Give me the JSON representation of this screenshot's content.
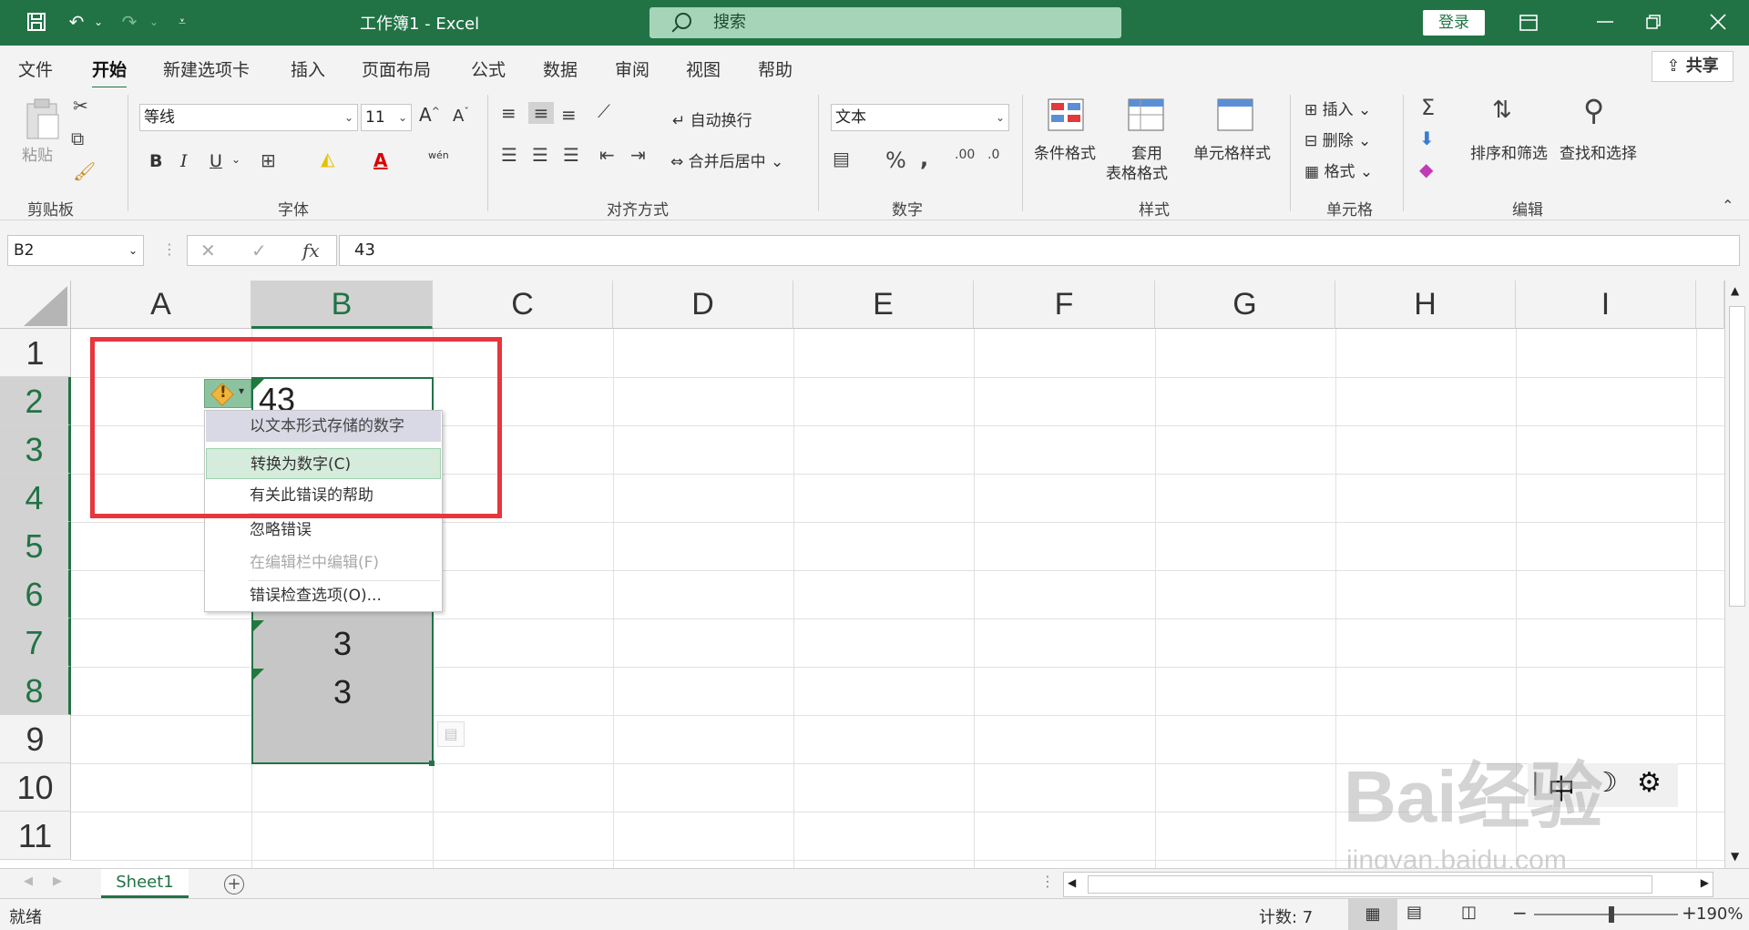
{
  "titlebar": {
    "doc_title": "工作簿1  -  Excel",
    "search_placeholder": "搜索",
    "login": "登录"
  },
  "tabs": [
    {
      "label": "文件"
    },
    {
      "label": "开始"
    },
    {
      "label": "新建选项卡"
    },
    {
      "label": "插入"
    },
    {
      "label": "页面布局"
    },
    {
      "label": "公式"
    },
    {
      "label": "数据"
    },
    {
      "label": "审阅"
    },
    {
      "label": "视图"
    },
    {
      "label": "帮助"
    }
  ],
  "share_label": "共享",
  "ribbon": {
    "clipboard": {
      "paste": "粘贴",
      "group": "剪贴板"
    },
    "font": {
      "name": "等线",
      "size": "11",
      "group": "字体",
      "phonetic": "wén"
    },
    "alignment": {
      "wrap": "自动换行",
      "merge": "合并后居中",
      "group": "对齐方式"
    },
    "number": {
      "format": "文本",
      "group": "数字"
    },
    "styles": {
      "conditional": "条件格式",
      "table_line1": "套用",
      "table_line2": "表格格式",
      "cell_styles": "单元格样式",
      "group": "样式"
    },
    "cells": {
      "insert": "插入",
      "delete": "删除",
      "format": "格式",
      "group": "单元格"
    },
    "editing": {
      "sort": "排序和筛选",
      "find": "查找和选择",
      "group": "编辑"
    }
  },
  "formula_bar": {
    "name_box": "B2",
    "formula": "43"
  },
  "columns": [
    "A",
    "B",
    "C",
    "D",
    "E",
    "F",
    "G",
    "H",
    "I"
  ],
  "rows": [
    "1",
    "2",
    "3",
    "4",
    "5",
    "6",
    "7",
    "8",
    "9",
    "10",
    "11"
  ],
  "cells": {
    "B2": "43",
    "B7": "3",
    "B8": "3"
  },
  "error_menu": {
    "header": "以文本形式存储的数字",
    "convert": "转换为数字(C)",
    "help": "有关此错误的帮助",
    "ignore": "忽略错误",
    "edit_in_bar": "在编辑栏中编辑(F)",
    "options": "错误检查选项(O)..."
  },
  "sheet_tabs": [
    "Sheet1"
  ],
  "statusbar": {
    "ready": "就绪",
    "count": "计数: 7",
    "zoom": "190%"
  },
  "ime": {
    "mode": "中"
  },
  "watermark": {
    "text": "Bai经验",
    "url": "jingyan.baidu.com"
  },
  "colors": {
    "accent": "#217346",
    "highlight_box": "#e8353e"
  }
}
